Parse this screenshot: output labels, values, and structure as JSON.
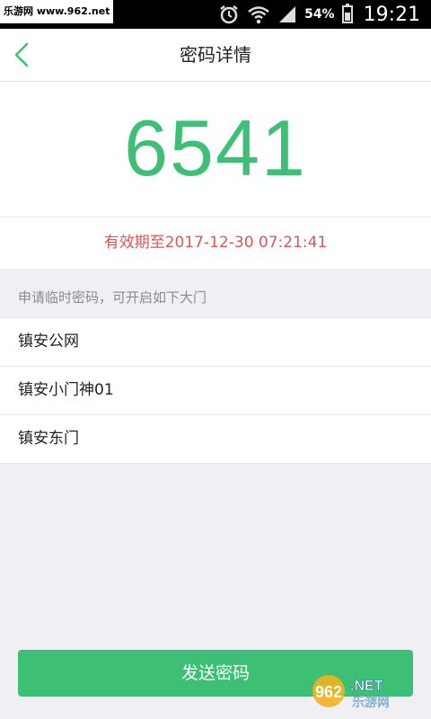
{
  "status_bar": {
    "site_label": "乐游网 www.962.net",
    "battery_pct": "54%",
    "time": "19:21",
    "icons": [
      "alarm-icon",
      "wifi-icon",
      "signal-icon",
      "battery-icon"
    ]
  },
  "header": {
    "title": "密码详情",
    "back_icon": "chevron-left-icon"
  },
  "password": {
    "code": "6541",
    "expiry": "有效期至2017-12-30 07:21:41"
  },
  "doors": {
    "section_title": "申请临时密码，可开启如下大门",
    "items": [
      {
        "label": "镇安公网"
      },
      {
        "label": "镇安小门神01"
      },
      {
        "label": "镇安东门"
      }
    ]
  },
  "actions": {
    "send_label": "发送密码"
  },
  "watermark": {
    "brand_number": "962",
    "brand_suffix": ".NET",
    "brand_cn": "乐游网"
  },
  "colors": {
    "accent": "#3dbf76",
    "expiry": "#e05555",
    "background": "#efeff4"
  }
}
